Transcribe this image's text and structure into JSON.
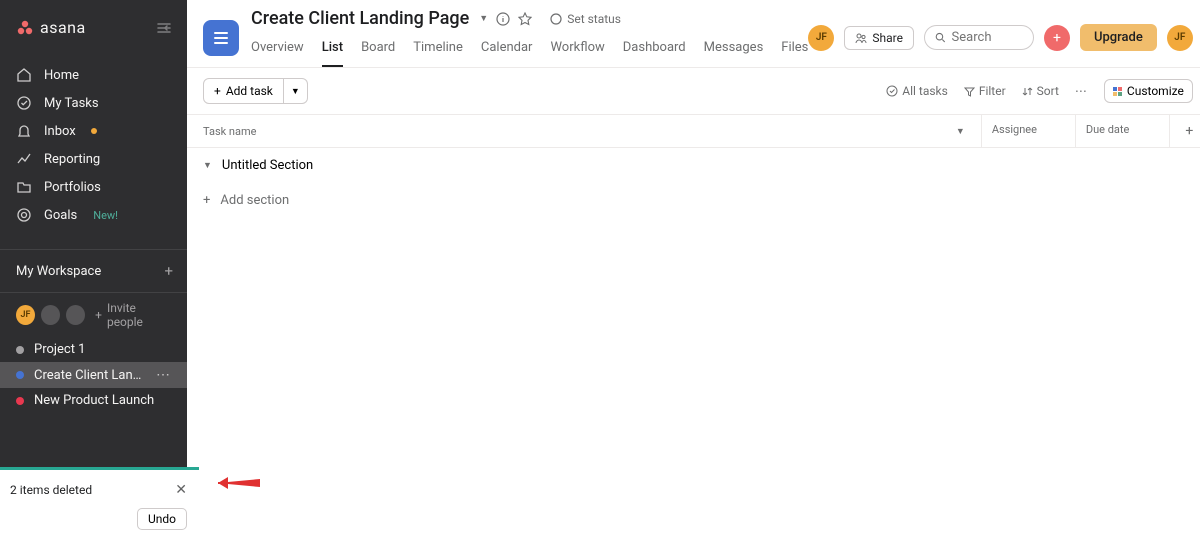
{
  "brand": "asana",
  "sidebar": {
    "nav": [
      {
        "label": "Home"
      },
      {
        "label": "My Tasks"
      },
      {
        "label": "Inbox"
      },
      {
        "label": "Reporting"
      },
      {
        "label": "Portfolios"
      },
      {
        "label": "Goals"
      }
    ],
    "goals_new": "New!",
    "workspace_label": "My Workspace",
    "invite_label": "Invite people",
    "user_initials": "JF",
    "projects": [
      {
        "name": "Project 1",
        "color": "#A2A0A2"
      },
      {
        "name": "Create Client Landin…",
        "color": "#4573D2"
      },
      {
        "name": "New Product Launch",
        "color": "#E8384F"
      }
    ]
  },
  "header": {
    "title": "Create Client Landing Page",
    "set_status": "Set status",
    "share": "Share",
    "search_placeholder": "Search",
    "upgrade": "Upgrade",
    "avatar": "JF",
    "tabs": [
      "Overview",
      "List",
      "Board",
      "Timeline",
      "Calendar",
      "Workflow",
      "Dashboard",
      "Messages",
      "Files"
    ],
    "active_tab": "List"
  },
  "toolbar": {
    "add_task": "Add task",
    "all_tasks": "All tasks",
    "filter": "Filter",
    "sort": "Sort",
    "customize": "Customize"
  },
  "columns": {
    "task_name": "Task name",
    "assignee": "Assignee",
    "due_date": "Due date"
  },
  "list": {
    "section_name": "Untitled Section",
    "add_section": "Add section"
  },
  "toast": {
    "message": "2 items deleted",
    "undo": "Undo"
  }
}
